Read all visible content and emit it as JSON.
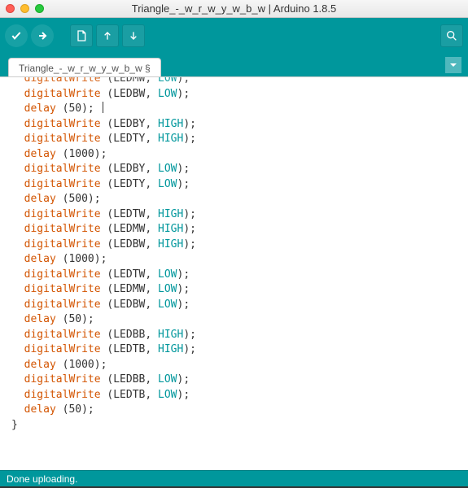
{
  "window": {
    "title": "Triangle_-_w_r_w_y_w_b_w | Arduino 1.8.5"
  },
  "tab": {
    "label": "Triangle_-_w_r_w_y_w_b_w §"
  },
  "status": {
    "text": "Done uploading."
  },
  "code": {
    "lines": [
      {
        "type": "call",
        "fn": "digitalWrite",
        "args": "(LEDMW, ",
        "kw": "LOW",
        "tail": ");",
        "partial": true
      },
      {
        "type": "call",
        "fn": "digitalWrite",
        "args": "(LEDBW, ",
        "kw": "LOW",
        "tail": ");"
      },
      {
        "type": "call",
        "fn": "delay",
        "args": "(50);",
        "cursor": true
      },
      {
        "type": "call",
        "fn": "digitalWrite",
        "args": "(LEDBY, ",
        "kw": "HIGH",
        "tail": ");"
      },
      {
        "type": "call",
        "fn": "digitalWrite",
        "args": "(LEDTY, ",
        "kw": "HIGH",
        "tail": ");"
      },
      {
        "type": "call",
        "fn": "delay",
        "args": "(1000);"
      },
      {
        "type": "call",
        "fn": "digitalWrite",
        "args": "(LEDBY, ",
        "kw": "LOW",
        "tail": ");"
      },
      {
        "type": "call",
        "fn": "digitalWrite",
        "args": "(LEDTY, ",
        "kw": "LOW",
        "tail": ");"
      },
      {
        "type": "call",
        "fn": "delay",
        "args": "(500);"
      },
      {
        "type": "call",
        "fn": "digitalWrite",
        "args": "(LEDTW, ",
        "kw": "HIGH",
        "tail": ");"
      },
      {
        "type": "call",
        "fn": "digitalWrite",
        "args": "(LEDMW, ",
        "kw": "HIGH",
        "tail": ");"
      },
      {
        "type": "call",
        "fn": "digitalWrite",
        "args": "(LEDBW, ",
        "kw": "HIGH",
        "tail": ");"
      },
      {
        "type": "call",
        "fn": "delay",
        "args": "(1000);"
      },
      {
        "type": "call",
        "fn": "digitalWrite",
        "args": "(LEDTW, ",
        "kw": "LOW",
        "tail": ");"
      },
      {
        "type": "call",
        "fn": "digitalWrite",
        "args": "(LEDMW, ",
        "kw": "LOW",
        "tail": ");"
      },
      {
        "type": "call",
        "fn": "digitalWrite",
        "args": "(LEDBW, ",
        "kw": "LOW",
        "tail": ");"
      },
      {
        "type": "call",
        "fn": "delay",
        "args": "(50);"
      },
      {
        "type": "call",
        "fn": "digitalWrite",
        "args": "(LEDBB, ",
        "kw": "HIGH",
        "tail": ");"
      },
      {
        "type": "call",
        "fn": "digitalWrite",
        "args": "(LEDTB, ",
        "kw": "HIGH",
        "tail": ");"
      },
      {
        "type": "call",
        "fn": "delay",
        "args": "(1000);"
      },
      {
        "type": "call",
        "fn": "digitalWrite",
        "args": "(LEDBB, ",
        "kw": "LOW",
        "tail": ");"
      },
      {
        "type": "call",
        "fn": "digitalWrite",
        "args": "(LEDTB, ",
        "kw": "LOW",
        "tail": ");"
      },
      {
        "type": "call",
        "fn": "delay",
        "args": "(50);"
      },
      {
        "type": "plain",
        "text": "}"
      }
    ]
  }
}
